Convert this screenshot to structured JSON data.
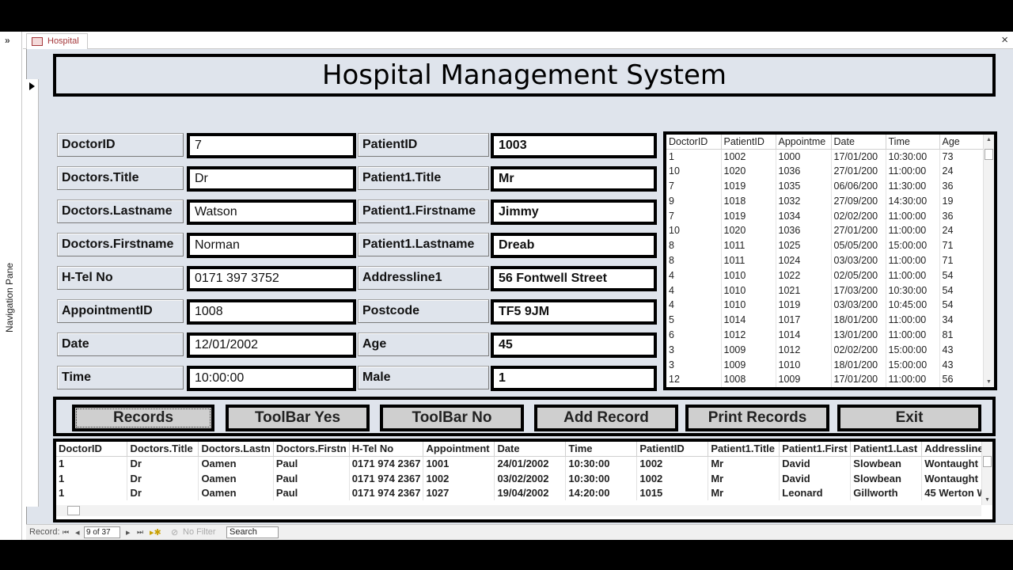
{
  "nav": {
    "toggle": "»",
    "label": "Navigation Pane"
  },
  "tab": {
    "label": "Hospital",
    "close": "×"
  },
  "title": "Hospital Management System",
  "fields_left": [
    {
      "label": "DoctorID",
      "value": "7"
    },
    {
      "label": "Doctors.Title",
      "value": "Dr"
    },
    {
      "label": "Doctors.Lastname",
      "value": "Watson"
    },
    {
      "label": "Doctors.Firstname",
      "value": "Norman"
    },
    {
      "label": "H-Tel No",
      "value": "0171 397 3752"
    },
    {
      "label": "AppointmentID",
      "value": "1008"
    },
    {
      "label": "Date",
      "value": "12/01/2002"
    },
    {
      "label": "Time",
      "value": "10:00:00"
    }
  ],
  "fields_right": [
    {
      "label": "PatientID",
      "value": "1003"
    },
    {
      "label": "Patient1.Title",
      "value": "Mr"
    },
    {
      "label": "Patient1.Firstname",
      "value": "Jimmy"
    },
    {
      "label": "Patient1.Lastname",
      "value": "Dreab"
    },
    {
      "label": "Addressline1",
      "value": "56 Fontwell Street"
    },
    {
      "label": "Postcode",
      "value": "TF5 9JM"
    },
    {
      "label": "Age",
      "value": "45"
    },
    {
      "label": "Male",
      "value": "1"
    }
  ],
  "right_grid": {
    "columns": [
      "DoctorID",
      "PatientID",
      "Appointme",
      "Date",
      "Time",
      "Age"
    ],
    "rows": [
      [
        "1",
        "1002",
        "1000",
        "17/01/200",
        "10:30:00",
        "73"
      ],
      [
        "10",
        "1020",
        "1036",
        "27/01/200",
        "11:00:00",
        "24"
      ],
      [
        "7",
        "1019",
        "1035",
        "06/06/200",
        "11:30:00",
        "36"
      ],
      [
        "9",
        "1018",
        "1032",
        "27/09/200",
        "14:30:00",
        "19"
      ],
      [
        "7",
        "1019",
        "1034",
        "02/02/200",
        "11:00:00",
        "36"
      ],
      [
        "10",
        "1020",
        "1036",
        "27/01/200",
        "11:00:00",
        "24"
      ],
      [
        "8",
        "1011",
        "1025",
        "05/05/200",
        "15:00:00",
        "71"
      ],
      [
        "8",
        "1011",
        "1024",
        "03/03/200",
        "11:00:00",
        "71"
      ],
      [
        "4",
        "1010",
        "1022",
        "02/05/200",
        "11:00:00",
        "54"
      ],
      [
        "4",
        "1010",
        "1021",
        "17/03/200",
        "10:30:00",
        "54"
      ],
      [
        "4",
        "1010",
        "1019",
        "03/03/200",
        "10:45:00",
        "54"
      ],
      [
        "5",
        "1014",
        "1017",
        "18/01/200",
        "11:00:00",
        "34"
      ],
      [
        "6",
        "1012",
        "1014",
        "13/01/200",
        "11:00:00",
        "81"
      ],
      [
        "3",
        "1009",
        "1012",
        "02/02/200",
        "15:00:00",
        "43"
      ],
      [
        "3",
        "1009",
        "1010",
        "18/01/200",
        "15:00:00",
        "43"
      ],
      [
        "12",
        "1008",
        "1009",
        "17/01/200",
        "11:00:00",
        "56"
      ]
    ]
  },
  "buttons": [
    "Records",
    "ToolBar Yes",
    "ToolBar No",
    "Add Record",
    "Print Records",
    "Exit"
  ],
  "bottom_grid": {
    "columns": [
      "DoctorID",
      "Doctors.Title",
      "Doctors.Lastn",
      "Doctors.Firstn",
      "H-Tel No",
      "Appointment",
      "Date",
      "Time",
      "PatientID",
      "Patient1.Title",
      "Patient1.First",
      "Patient1.Last",
      "Addressline1"
    ],
    "rows": [
      [
        "1",
        "Dr",
        "Oamen",
        "Paul",
        "0171 974 2367",
        "1001",
        "24/01/2002",
        "10:30:00",
        "1002",
        "Mr",
        "David",
        "Slowbean",
        "Wontaught"
      ],
      [
        "1",
        "Dr",
        "Oamen",
        "Paul",
        "0171 974 2367",
        "1002",
        "03/02/2002",
        "10:30:00",
        "1002",
        "Mr",
        "David",
        "Slowbean",
        "Wontaught"
      ],
      [
        "1",
        "Dr",
        "Oamen",
        "Paul",
        "0171 974 2367",
        "1027",
        "19/04/2002",
        "14:20:00",
        "1015",
        "Mr",
        "Leonard",
        "Gillworth",
        "45 Werton W"
      ]
    ]
  },
  "status": {
    "record_label": "Record:",
    "record_position": "9 of 37",
    "nav_first": "⏮",
    "nav_prev": "◂",
    "nav_next": "▸",
    "nav_last": "⏭",
    "nav_new": "▸✱",
    "filter": "No Filter",
    "search": "Search"
  }
}
